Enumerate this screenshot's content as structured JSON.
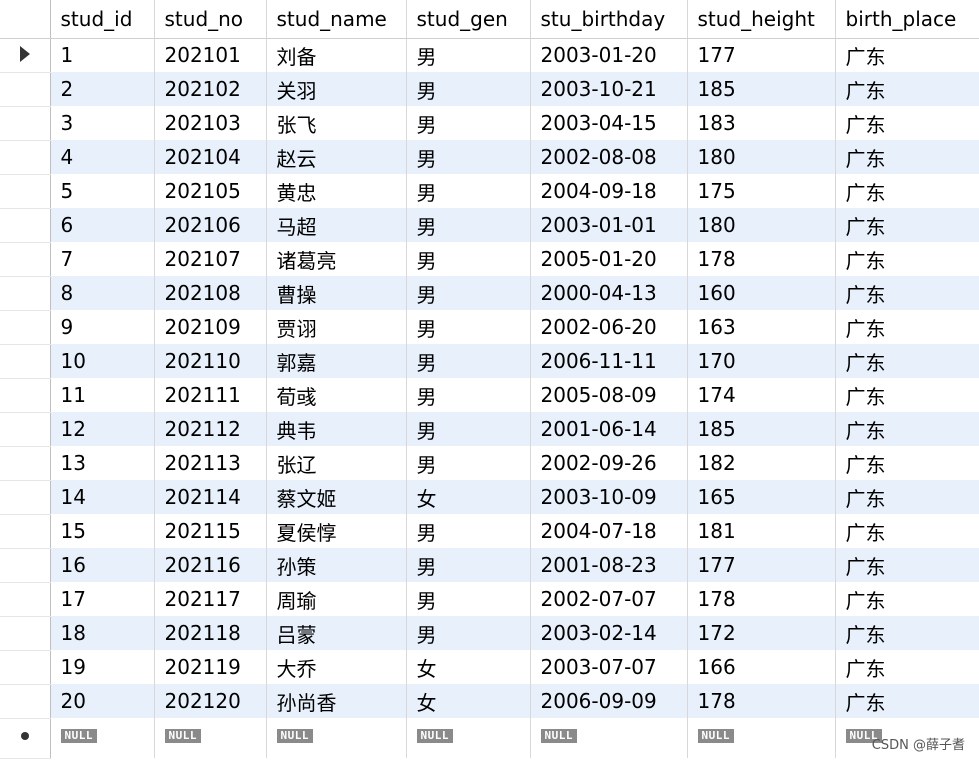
{
  "columns": [
    "stud_id",
    "stud_no",
    "stud_name",
    "stud_gen",
    "stu_birthday",
    "stud_height",
    "birth_place"
  ],
  "rows": [
    [
      "1",
      "202101",
      "刘备",
      "男",
      "2003-01-20",
      "177",
      "广东"
    ],
    [
      "2",
      "202102",
      "关羽",
      "男",
      "2003-10-21",
      "185",
      "广东"
    ],
    [
      "3",
      "202103",
      "张飞",
      "男",
      "2003-04-15",
      "183",
      "广东"
    ],
    [
      "4",
      "202104",
      "赵云",
      "男",
      "2002-08-08",
      "180",
      "广东"
    ],
    [
      "5",
      "202105",
      "黄忠",
      "男",
      "2004-09-18",
      "175",
      "广东"
    ],
    [
      "6",
      "202106",
      "马超",
      "男",
      "2003-01-01",
      "180",
      "广东"
    ],
    [
      "7",
      "202107",
      "诸葛亮",
      "男",
      "2005-01-20",
      "178",
      "广东"
    ],
    [
      "8",
      "202108",
      "曹操",
      "男",
      "2000-04-13",
      "160",
      "广东"
    ],
    [
      "9",
      "202109",
      "贾诩",
      "男",
      "2002-06-20",
      "163",
      "广东"
    ],
    [
      "10",
      "202110",
      "郭嘉",
      "男",
      "2006-11-11",
      "170",
      "广东"
    ],
    [
      "11",
      "202111",
      "荀彧",
      "男",
      "2005-08-09",
      "174",
      "广东"
    ],
    [
      "12",
      "202112",
      "典韦",
      "男",
      "2001-06-14",
      "185",
      "广东"
    ],
    [
      "13",
      "202113",
      "张辽",
      "男",
      "2002-09-26",
      "182",
      "广东"
    ],
    [
      "14",
      "202114",
      "蔡文姬",
      "女",
      "2003-10-09",
      "165",
      "广东"
    ],
    [
      "15",
      "202115",
      "夏侯惇",
      "男",
      "2004-07-18",
      "181",
      "广东"
    ],
    [
      "16",
      "202116",
      "孙策",
      "男",
      "2001-08-23",
      "177",
      "广东"
    ],
    [
      "17",
      "202117",
      "周瑜",
      "男",
      "2002-07-07",
      "178",
      "广东"
    ],
    [
      "18",
      "202118",
      "吕蒙",
      "男",
      "2003-02-14",
      "172",
      "广东"
    ],
    [
      "19",
      "202119",
      "大乔",
      "女",
      "2003-07-07",
      "166",
      "广东"
    ],
    [
      "20",
      "202120",
      "孙尚香",
      "女",
      "2006-09-09",
      "178",
      "广东"
    ]
  ],
  "null_label": "NULL",
  "watermark": "CSDN @薛子耆",
  "icons": {
    "current_row": "row-pointer-arrow-icon",
    "new_row": "new-row-dot-icon"
  }
}
